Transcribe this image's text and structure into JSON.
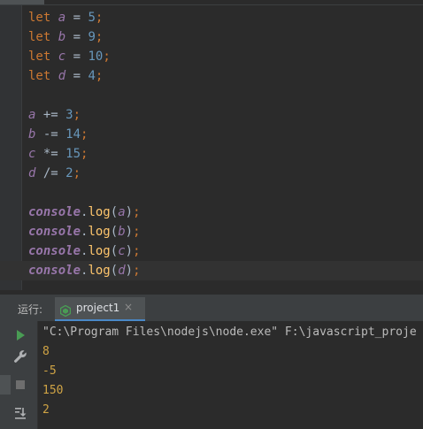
{
  "editor": {
    "lines": [
      {
        "kw": "let",
        "name": "a",
        "op": "=",
        "value": "5"
      },
      {
        "kw": "let",
        "name": "b",
        "op": "=",
        "value": "9"
      },
      {
        "kw": "let",
        "name": "c",
        "op": "=",
        "value": "10"
      },
      {
        "kw": "let",
        "name": "d",
        "op": "=",
        "value": "4"
      },
      {
        "blank": true
      },
      {
        "name": "a",
        "op": "+=",
        "value": "3"
      },
      {
        "name": "b",
        "op": "-=",
        "value": "14"
      },
      {
        "name": "c",
        "op": "*=",
        "value": "15"
      },
      {
        "name": "d",
        "op": "/=",
        "value": "2"
      },
      {
        "blank": true
      },
      {
        "obj": "console",
        "fn": "log",
        "arg": "a"
      },
      {
        "obj": "console",
        "fn": "log",
        "arg": "b"
      },
      {
        "obj": "console",
        "fn": "log",
        "arg": "c"
      },
      {
        "obj": "console",
        "fn": "log",
        "arg": "d",
        "current": true
      }
    ]
  },
  "run_panel": {
    "label": "运行:",
    "tab_name": "project1",
    "tab_close": "×",
    "command": "\"C:\\Program Files\\nodejs\\node.exe\" F:\\javascript_proje",
    "output": [
      "8",
      "-5",
      "150",
      "2"
    ]
  },
  "icons": {
    "run": "play-icon",
    "settings": "wrench-icon",
    "stop": "stop-icon",
    "scroll": "scroll-to-end-icon",
    "tab": "nodejs-icon"
  },
  "colors": {
    "background": "#2b2b2b",
    "keyword": "#cc7832",
    "variable": "#9876aa",
    "number": "#6897bb",
    "function": "#ffc66d",
    "output": "#d0a445",
    "run_green": "#499c54"
  }
}
